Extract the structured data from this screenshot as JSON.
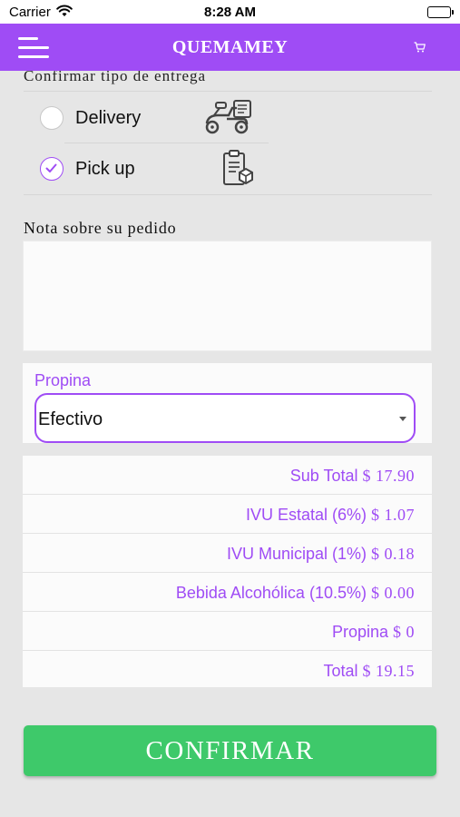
{
  "status_bar": {
    "carrier": "Carrier",
    "time": "8:28 AM"
  },
  "header": {
    "title": "QUEMAMEY",
    "menu_icon": "hamburger-menu-icon",
    "cart_icon": "cart-icon"
  },
  "delivery": {
    "section_title": "Confirmar tipo de entrega",
    "options": [
      {
        "label": "Delivery",
        "selected": false,
        "icon": "scooter-icon"
      },
      {
        "label": "Pick up",
        "selected": true,
        "icon": "clipboard-pickup-icon"
      }
    ]
  },
  "note": {
    "label": "Nota sobre su pedido",
    "value": ""
  },
  "tip": {
    "label": "Propina",
    "selected": "Efectivo"
  },
  "summary": {
    "rows": [
      {
        "label": "Sub Total",
        "amount": "$ 17.90"
      },
      {
        "label": "IVU Estatal (6%)",
        "amount": "$ 1.07"
      },
      {
        "label": "IVU Municipal (1%)",
        "amount": "$ 0.18"
      },
      {
        "label": "Bebida Alcohólica (10.5%)",
        "amount": "$ 0.00"
      },
      {
        "label": "Propina",
        "amount": "$ 0"
      },
      {
        "label": "Total",
        "amount": "$ 19.15"
      }
    ]
  },
  "confirm_button": {
    "label": "CONFIRMAR"
  },
  "colors": {
    "accent": "#9f4cf5",
    "confirm": "#3ec96a",
    "background": "#e6e6e6"
  }
}
